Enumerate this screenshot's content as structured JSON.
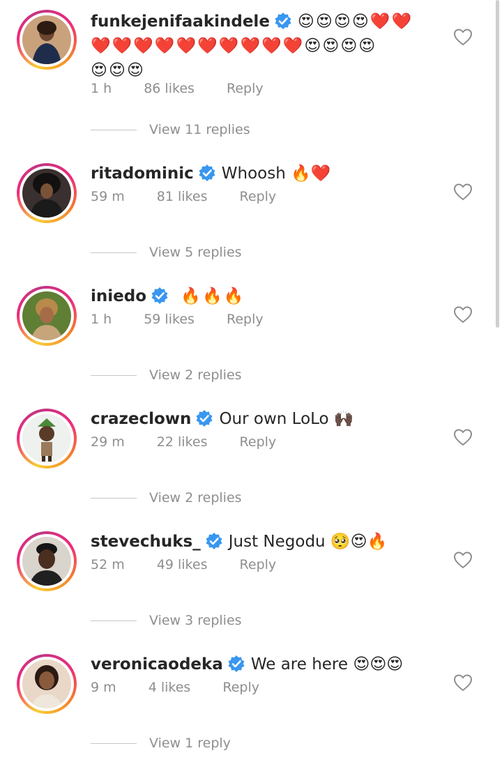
{
  "comments": [
    {
      "username": "funkejenifaakindele",
      "text_line1": "😍😍😍😍❤️❤️",
      "text_line2": "❤️❤️❤️❤️❤️❤️❤️❤️❤️❤️😍😍😍😍",
      "text_line3": "😍😍😍",
      "time": "1 h",
      "likes": "86 likes",
      "reply": "Reply",
      "view_replies": "View 11 replies",
      "avatar_bg": "#c9a27c"
    },
    {
      "username": "ritadominic",
      "text": "Whoosh 🔥❤️",
      "time": "59 m",
      "likes": "81 likes",
      "reply": "Reply",
      "view_replies": "View 5 replies",
      "avatar_bg": "#2a2a2a"
    },
    {
      "username": "iniedo",
      "text": " 🔥🔥🔥",
      "time": "1 h",
      "likes": "59 likes",
      "reply": "Reply",
      "view_replies": "View 2 replies",
      "avatar_bg": "#6a8a3a"
    },
    {
      "username": "crazeclown",
      "text": "Our own LoLo 🙌🏿",
      "time": "29 m",
      "likes": "22 likes",
      "reply": "Reply",
      "view_replies": "View 2 replies",
      "avatar_bg": "#e8ece8"
    },
    {
      "username": "stevechuks_",
      "text": "Just Negodu 🥺😍🔥",
      "time": "52 m",
      "likes": "49 likes",
      "reply": "Reply",
      "view_replies": "View 3 replies",
      "avatar_bg": "#d9d4cc"
    },
    {
      "username": "veronicaodeka",
      "text": "We are here 😍😍😍",
      "time": "9 m",
      "likes": "4 likes",
      "reply": "Reply",
      "view_replies": "View 1 reply",
      "avatar_bg": "#e9d8c8"
    }
  ],
  "colors": {
    "verified_blue": "#3897f0",
    "meta_gray": "#8e8e8e",
    "text_dark": "#262626"
  },
  "icons": {
    "verified": "verified-badge-icon",
    "like": "heart-outline-icon"
  }
}
